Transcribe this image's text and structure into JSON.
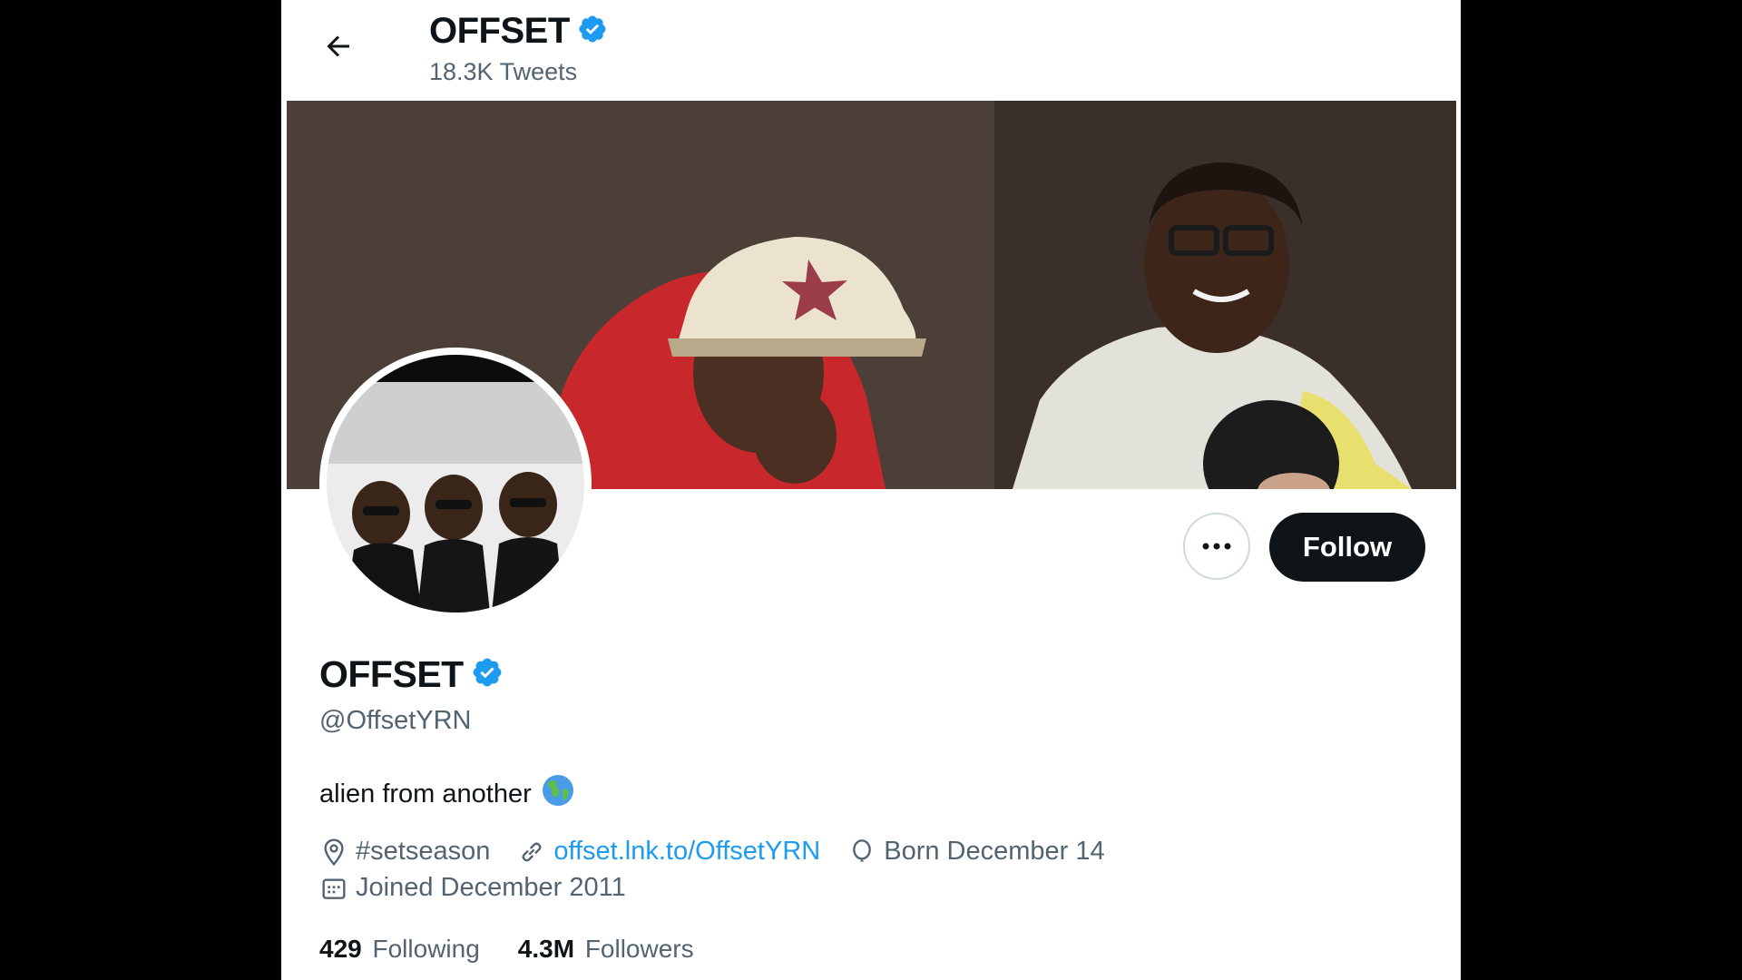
{
  "header": {
    "name": "OFFSET",
    "tweet_count": "18.3K Tweets"
  },
  "profile": {
    "display_name": "OFFSET",
    "handle": "@OffsetYRN",
    "bio": "alien from another",
    "bio_emoji": "globe-americas-icon",
    "location": "#setseason",
    "website": "offset.lnk.to/OffsetYRN",
    "birthday": "Born December 14",
    "joined": "Joined December 2011"
  },
  "actions": {
    "follow_label": "Follow"
  },
  "stats": {
    "following_count": "429",
    "following_label": "Following",
    "followers_count": "4.3M",
    "followers_label": "Followers"
  },
  "colors": {
    "verified": "#1d9bf0",
    "link": "#1d9bf0",
    "text_primary": "#0f1419",
    "text_secondary": "#536471",
    "follow_bg": "#0f1419"
  }
}
